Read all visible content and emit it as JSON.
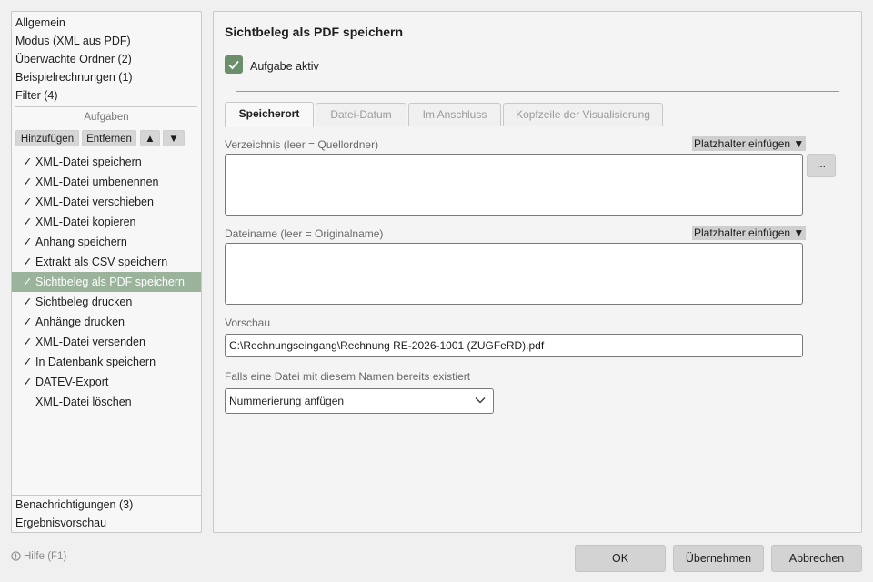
{
  "sidebar": {
    "top_items": [
      "Allgemein",
      "Modus (XML aus PDF)",
      "Überwachte Ordner (2)",
      "Beispielrechnungen (1)",
      "Filter (4)"
    ],
    "tasks_header": "Aufgaben",
    "buttons": {
      "add": "Hinzufügen",
      "remove": "Entfernen",
      "up": "▲",
      "down": "▼"
    },
    "tasks": [
      {
        "label": "XML-Datei speichern",
        "check": "✓"
      },
      {
        "label": "XML-Datei umbenennen",
        "check": "✓"
      },
      {
        "label": "XML-Datei verschieben",
        "check": "✓"
      },
      {
        "label": "XML-Datei kopieren",
        "check": "✓"
      },
      {
        "label": "Anhang speichern",
        "check": "✓"
      },
      {
        "label": "Extrakt als CSV speichern",
        "check": "✓"
      },
      {
        "label": "Sichtbeleg als PDF speichern",
        "check": "✓"
      },
      {
        "label": "Sichtbeleg drucken",
        "check": "✓"
      },
      {
        "label": "Anhänge drucken",
        "check": "✓"
      },
      {
        "label": "XML-Datei versenden",
        "check": "✓"
      },
      {
        "label": "In Datenbank speichern",
        "check": "✓"
      },
      {
        "label": "DATEV-Export",
        "check": "✓"
      },
      {
        "label": "XML-Datei löschen",
        "check": ""
      }
    ],
    "selected_task_index": 6,
    "bottom_items": [
      "Benachrichtigungen (3)",
      "Ergebnisvorschau"
    ]
  },
  "main": {
    "title": "Sichtbeleg als PDF speichern",
    "active_label": "Aufgabe aktiv",
    "active_checked": true,
    "tabs": [
      "Speicherort",
      "Datei-Datum",
      "Im Anschluss",
      "Kopfzeile der Visualisierung"
    ],
    "active_tab_index": 0,
    "directory_label": "Verzeichnis (leer = Quellordner)",
    "placeholder_button": "Platzhalter einfügen ▼",
    "browse_button": "...",
    "filename_label": "Dateiname (leer = Originalname)",
    "preview_label": "Vorschau",
    "preview_value": "C:\\Rechnungseingang\\Rechnung RE-2026-1001 (ZUGFeRD).pdf",
    "exists_label": "Falls eine Datei mit diesem Namen bereits existiert",
    "exists_value": "Nummerierung anfügen"
  },
  "footer": {
    "help": "Hilfe (F1)",
    "ok": "OK",
    "apply": "Übernehmen",
    "cancel": "Abbrechen"
  },
  "colors": {
    "accent": "#9ab39a",
    "checkbox": "#6a8f6a"
  }
}
